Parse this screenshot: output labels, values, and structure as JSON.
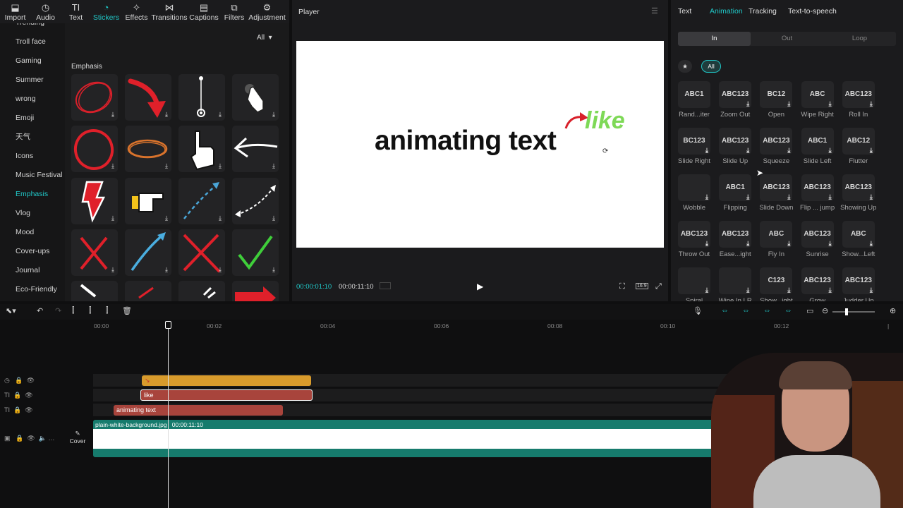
{
  "toolbar": {
    "items": [
      {
        "label": "Import",
        "icon": "import-icon"
      },
      {
        "label": "Audio",
        "icon": "audio-icon"
      },
      {
        "label": "Text",
        "icon": "text-icon"
      },
      {
        "label": "Stickers",
        "icon": "stickers-icon",
        "active": true
      },
      {
        "label": "Effects",
        "icon": "effects-icon"
      },
      {
        "label": "Transitions",
        "icon": "transitions-icon"
      },
      {
        "label": "Captions",
        "icon": "captions-icon"
      },
      {
        "label": "Filters",
        "icon": "filters-icon"
      },
      {
        "label": "Adjustment",
        "icon": "adjustment-icon"
      }
    ]
  },
  "sidebar": {
    "items": [
      "Trending",
      "Troll face",
      "Gaming",
      "Summer",
      "wrong",
      "Emoji",
      "天气",
      "Icons",
      "Music Festival",
      "Emphasis",
      "Vlog",
      "Mood",
      "Cover-ups",
      "Journal",
      "Eco-Friendly"
    ],
    "active": "Emphasis"
  },
  "stickers": {
    "filter_label": "All",
    "section_title": "Emphasis"
  },
  "player": {
    "title": "Player",
    "canvas_text": "animating text",
    "overlay_text": "like",
    "current_time": "00:00:01:10",
    "total_time": "00:00:11:10",
    "aspect": "16:9"
  },
  "right_panel": {
    "tabs": [
      "Text",
      "Animation",
      "Tracking",
      "Text-to-speech"
    ],
    "active_tab": "Animation",
    "subtabs": [
      "In",
      "Out",
      "Loop"
    ],
    "active_subtab": "In",
    "all_label": "All",
    "animations": [
      {
        "thumb": "ABC1",
        "label": "Rand...iter"
      },
      {
        "thumb": "ABC123",
        "label": "Zoom Out"
      },
      {
        "thumb": "BC12",
        "label": "Open"
      },
      {
        "thumb": "ABC",
        "label": "Wipe Right"
      },
      {
        "thumb": "ABC123",
        "label": "Roll In"
      },
      {
        "thumb": "BC123",
        "label": "Slide Right"
      },
      {
        "thumb": "ABC123",
        "label": "Slide Up"
      },
      {
        "thumb": "ABC123",
        "label": "Squeeze"
      },
      {
        "thumb": "ABC1",
        "label": "Slide Left"
      },
      {
        "thumb": "ABC12",
        "label": "Flutter"
      },
      {
        "thumb": "",
        "label": "Wobble"
      },
      {
        "thumb": "ABC1",
        "label": "Flipping"
      },
      {
        "thumb": "ABC123",
        "label": "Slide Down"
      },
      {
        "thumb": "ABC123",
        "label": "Flip ... jump"
      },
      {
        "thumb": "ABC123",
        "label": "Showing Up"
      },
      {
        "thumb": "ABC123",
        "label": "Throw Out"
      },
      {
        "thumb": "ABC123",
        "label": "Ease...ight"
      },
      {
        "thumb": "ABC",
        "label": "Fly In"
      },
      {
        "thumb": "ABC123",
        "label": "Sunrise"
      },
      {
        "thumb": "ABC",
        "label": "Show...Left"
      },
      {
        "thumb": "",
        "label": "Spiral"
      },
      {
        "thumb": "",
        "label": "Wipe In LR"
      },
      {
        "thumb": "C123",
        "label": "Show...ight"
      },
      {
        "thumb": "ABC123",
        "label": "Grow"
      },
      {
        "thumb": "ABC123",
        "label": "Judder Up"
      }
    ]
  },
  "timeline": {
    "ticks": [
      "00:00",
      "00:02",
      "00:04",
      "00:06",
      "00:08",
      "00:10",
      "00:12"
    ],
    "clips": {
      "sticker": "",
      "like": "like",
      "text": "animating text",
      "video_name": "plain-white-background.jpg",
      "video_duration": "00:00:11:10"
    },
    "cover_label": "Cover"
  },
  "colors": {
    "accent": "#20c8c8",
    "like_green": "#7ed957",
    "sticker_clip": "#d89b2c",
    "text_clip": "#a8443c",
    "video_clip": "#167b6d"
  }
}
